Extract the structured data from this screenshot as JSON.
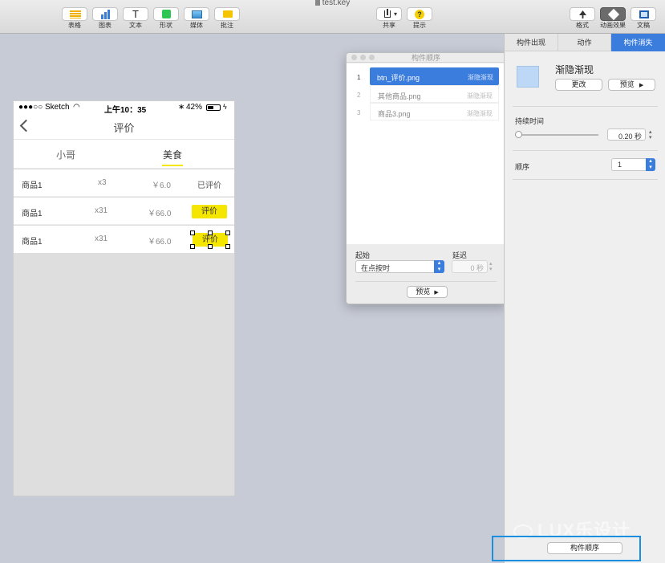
{
  "window": {
    "title": "test.key"
  },
  "toolbar": {
    "left": [
      {
        "label": "表格",
        "icon": "table-icon"
      },
      {
        "label": "图表",
        "icon": "chart-icon"
      },
      {
        "label": "文本",
        "icon": "text-icon"
      },
      {
        "label": "形状",
        "icon": "shape-icon"
      },
      {
        "label": "媒体",
        "icon": "media-icon"
      },
      {
        "label": "批注",
        "icon": "comment-icon"
      }
    ],
    "center": [
      {
        "label": "共享",
        "icon": "share-icon"
      },
      {
        "label": "提示",
        "icon": "tips-icon"
      }
    ],
    "right": [
      {
        "label": "格式",
        "icon": "format-icon"
      },
      {
        "label": "动画效果",
        "icon": "animate-icon"
      },
      {
        "label": "文稿",
        "icon": "document-icon"
      }
    ],
    "text_glyph": "T",
    "tips_glyph": "?"
  },
  "phone": {
    "status": {
      "carrier": "●●●○○ Sketch",
      "time": "上午10：35",
      "battery": "42%"
    },
    "nav_title": "评价",
    "tabs": [
      "小哥",
      "美食"
    ],
    "active_tab": 1,
    "rows": [
      {
        "name": "商品1",
        "qty": "x3",
        "price": "￥6.0",
        "action": "已评价",
        "style": "text"
      },
      {
        "name": "商品1",
        "qty": "x31",
        "price": "￥66.0",
        "action": "评价",
        "style": "button"
      },
      {
        "name": "商品1",
        "qty": "x31",
        "price": "￥66.0",
        "action": "评价",
        "style": "selected"
      }
    ],
    "accent": "#f5e600"
  },
  "order_panel": {
    "title": "构件顺序",
    "items": [
      {
        "num": "1",
        "name": "btn_评价.png",
        "effect": "渐隐渐现",
        "selected": true
      },
      {
        "num": "2",
        "name": "其他商品.png",
        "effect": "渐隐渐现",
        "selected": false
      },
      {
        "num": "3",
        "name": "商品3.png",
        "effect": "渐隐渐现",
        "selected": false
      }
    ],
    "start_label": "起始",
    "start_value": "在点按时",
    "delay_label": "延迟",
    "delay_value": "0 秒",
    "preview_button": "预览"
  },
  "inspector": {
    "tabs": [
      "构件出现",
      "动作",
      "构件消失"
    ],
    "active_tab": 2,
    "effect_name": "渐隐渐现",
    "change_button": "更改",
    "preview_button": "预览",
    "duration_label": "持续时间",
    "duration_value": "0.20 秒",
    "duration_level": 0.04,
    "order_label": "顺序",
    "order_value": "1",
    "build_order_button": "构件顺序"
  },
  "watermark": "LUX乐设计",
  "colors": {
    "selection_blue": "#3b7ddd",
    "highlight_yellow": "#f5e600",
    "callout_blue": "#1a8fe0"
  }
}
